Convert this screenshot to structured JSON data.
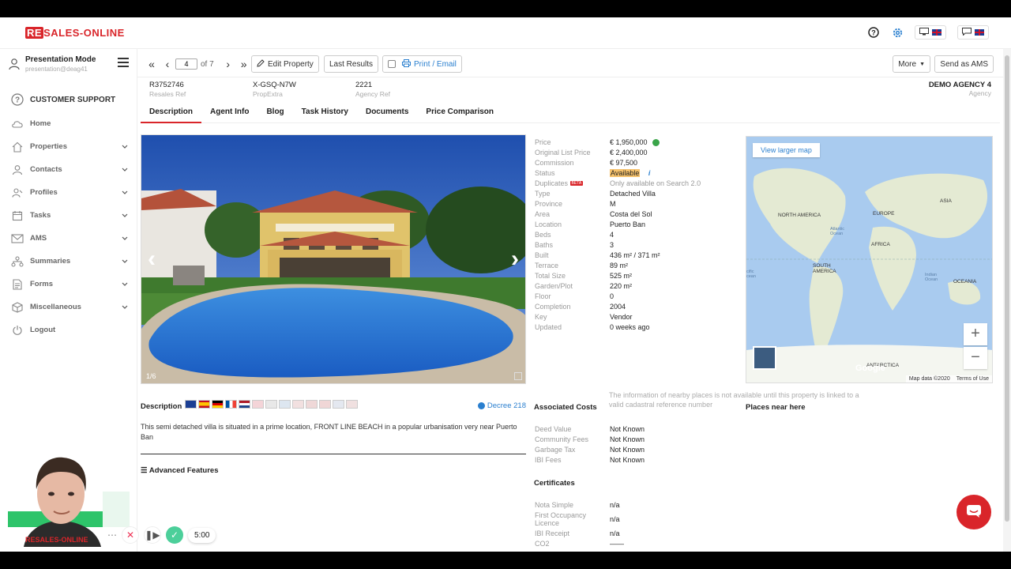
{
  "header": {
    "logo_re": "RE",
    "logo_rest": "SALES-ONLINE"
  },
  "sidebar": {
    "user_name": "Presentation Mode",
    "user_email": "presentation@deag41",
    "support": "CUSTOMER SUPPORT",
    "items": [
      {
        "label": "Home",
        "icon": "cloud-home-icon"
      },
      {
        "label": "Properties",
        "icon": "house-icon"
      },
      {
        "label": "Contacts",
        "icon": "person-icon"
      },
      {
        "label": "Profiles",
        "icon": "profile-icon"
      },
      {
        "label": "Tasks",
        "icon": "calendar-icon"
      },
      {
        "label": "AMS",
        "icon": "envelope-icon"
      },
      {
        "label": "Summaries",
        "icon": "sitemap-icon"
      },
      {
        "label": "Forms",
        "icon": "document-icon"
      },
      {
        "label": "Miscellaneous",
        "icon": "cube-icon"
      },
      {
        "label": "Logout",
        "icon": "power-icon"
      }
    ]
  },
  "toolbar": {
    "page": "4",
    "of_pages": "of 7",
    "edit_label": "Edit Property",
    "last_results": "Last Results",
    "print_label": "Print / Email",
    "more_label": "More",
    "send_ams": "Send as AMS"
  },
  "refs": {
    "resales_ref": "R3752746",
    "resales_ref_label": "Resales Ref",
    "propextra": "X-GSQ-N7W",
    "propextra_label": "PropExtra",
    "agency_ref": "2221",
    "agency_ref_label": "Agency Ref",
    "agency_name": "DEMO AGENCY 4",
    "agency_label": "Agency"
  },
  "tabs": [
    "Description",
    "Agent Info",
    "Blog",
    "Task History",
    "Documents",
    "Price Comparison"
  ],
  "photo": {
    "counter": "1/6"
  },
  "details": [
    {
      "label": "Price",
      "value": "€ 1,950,000"
    },
    {
      "label": "Original List Price",
      "value": "€ 2,400,000"
    },
    {
      "label": "Commission",
      "value": "€ 97,500"
    },
    {
      "label": "Status",
      "value": "Available"
    },
    {
      "label": "Duplicates",
      "value": "Only available on Search 2.0"
    },
    {
      "label": "Type",
      "value": "Detached Villa"
    },
    {
      "label": "Province",
      "value": "M"
    },
    {
      "label": "Area",
      "value": "Costa del Sol"
    },
    {
      "label": "Location",
      "value": "Puerto Ban"
    },
    {
      "label": "Beds",
      "value": "4"
    },
    {
      "label": "Baths",
      "value": "3"
    },
    {
      "label": "Built",
      "value": "436 m² / 371 m²"
    },
    {
      "label": "Terrace",
      "value": "89 m²"
    },
    {
      "label": "Total Size",
      "value": "525 m²"
    },
    {
      "label": "Garden/Plot",
      "value": "220 m²"
    },
    {
      "label": "Floor",
      "value": "0"
    },
    {
      "label": "Completion",
      "value": "2004"
    },
    {
      "label": "Key",
      "value": "Vendor"
    },
    {
      "label": "Updated",
      "value": "0 weeks ago"
    }
  ],
  "beta_badge": "BETA",
  "map": {
    "view_larger": "View larger map",
    "zoom_in": "+",
    "zoom_out": "−",
    "map_data": "Map data ©2020",
    "terms": "Terms of Use",
    "google": "Google",
    "labels": {
      "north_america": "NORTH AMERICA",
      "europe": "EUROPE",
      "asia": "ASIA",
      "africa": "AFRICA",
      "south_america": "SOUTH AMERICA",
      "oceania": "OCEANIA",
      "antarctica": "ANTARCTICA",
      "atlantic": "Atlantic Ocean",
      "pacific": "cific cean",
      "indian": "Indian Ocean"
    }
  },
  "description": {
    "title": "Description",
    "decree": "Decree 218",
    "text": "This semi detached villa is situated in a prime location, FRONT LINE BEACH in a popular urbanisation very near Puerto Ban",
    "advanced": "Advanced Features"
  },
  "costs": {
    "title": "Associated Costs",
    "rows": [
      {
        "label": "Deed Value",
        "value": "Not Known"
      },
      {
        "label": "Community Fees",
        "value": "Not Known"
      },
      {
        "label": "Garbage Tax",
        "value": "Not Known"
      },
      {
        "label": "IBI Fees",
        "value": "Not Known"
      }
    ]
  },
  "certificates": {
    "title": "Certificates",
    "rows": [
      {
        "label": "Nota Simple",
        "value": "n/a"
      },
      {
        "label": "First Occupancy Licence",
        "value": "n/a"
      },
      {
        "label": "IBI Receipt",
        "value": "n/a"
      },
      {
        "label": "CO2",
        "value": "——"
      }
    ]
  },
  "places": {
    "title": "Places near here",
    "info": "The information of nearby places is not available until this property is linked to a valid cadastral reference number"
  },
  "recorder": {
    "timer": "5:00",
    "webcam_brand": "RESALES-ONLINE"
  },
  "colors": {
    "brand_red": "#d9252a",
    "link_blue": "#2a7fcf",
    "status_available": "#f5c16b"
  }
}
